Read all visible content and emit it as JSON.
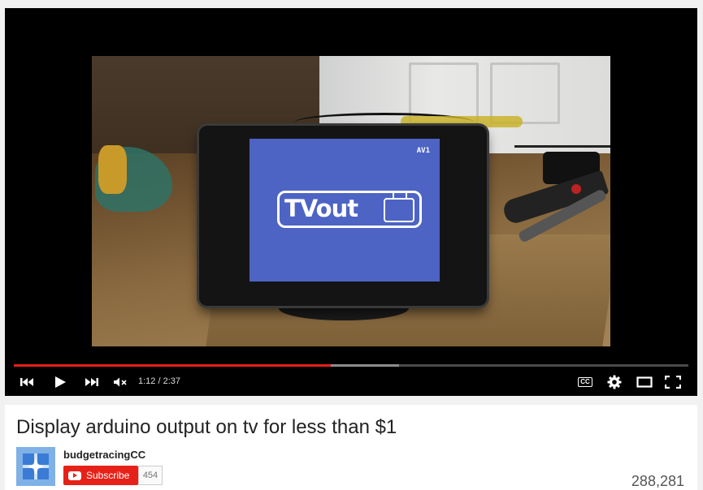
{
  "player": {
    "screen_badge": "AV1",
    "screen_logo_text": "TVout",
    "progress_fraction": 0.47,
    "buffered_fraction": 0.571,
    "time_display": "1:12 / 2:37",
    "controls": {
      "prev_icon": "skip-previous-icon",
      "play_icon": "play-icon",
      "next_icon": "skip-next-icon",
      "volume_icon": "volume-muted-icon",
      "cc_label": "CC",
      "settings_icon": "gear-icon",
      "theater_icon": "theater-mode-icon",
      "fullscreen_icon": "fullscreen-icon"
    }
  },
  "video": {
    "title": "Display arduino output on tv for less than $1",
    "channel": "budgetracingCC",
    "subscribe_label": "Subscribe",
    "subscriber_count": "454",
    "view_count": "288,281"
  },
  "colors": {
    "accent": "#e62117",
    "avatar": "#7fb1e6",
    "tv_screen": "#4d64c4"
  }
}
